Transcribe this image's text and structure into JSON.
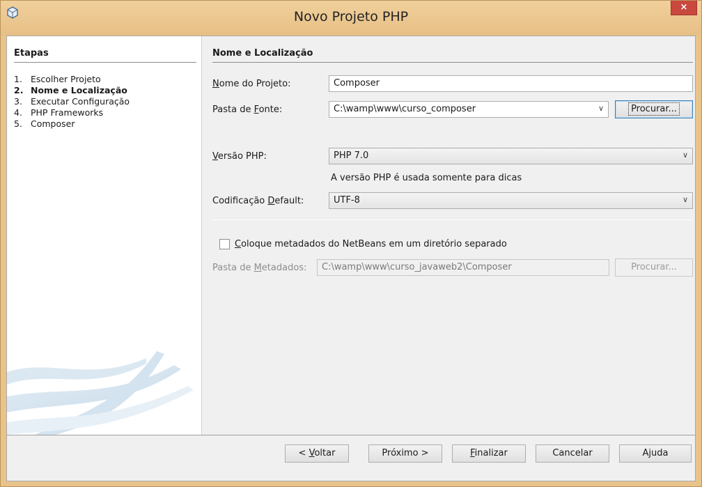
{
  "window": {
    "title": "Novo Projeto PHP",
    "close_label": "×"
  },
  "steps": {
    "title": "Etapas",
    "items": [
      {
        "num": "1.",
        "label": "Escolher Projeto",
        "current": false
      },
      {
        "num": "2.",
        "label": "Nome e Localização",
        "current": true
      },
      {
        "num": "3.",
        "label": "Executar Configuração",
        "current": false
      },
      {
        "num": "4.",
        "label": "PHP Frameworks",
        "current": false
      },
      {
        "num": "5.",
        "label": "Composer",
        "current": false
      }
    ]
  },
  "form": {
    "section_title": "Nome e Localização",
    "project_name": {
      "label_pre": "",
      "label_u": "N",
      "label_post": "ome do Projeto:",
      "value": "Composer"
    },
    "source_folder": {
      "label_pre": "Pasta de ",
      "label_u": "F",
      "label_post": "onte:",
      "value": "C:\\wamp\\www\\curso_composer",
      "browse_label": "Procurar..."
    },
    "php_version": {
      "label_pre": "",
      "label_u": "V",
      "label_post": "ersão PHP:",
      "value": "PHP 7.0",
      "hint": "A versão PHP é usada somente para dicas"
    },
    "encoding": {
      "label_pre": "Codificação ",
      "label_u": "D",
      "label_post": "efault:",
      "value": "UTF-8"
    },
    "metadata_checkbox": {
      "label_pre": "",
      "label_u": "C",
      "label_post": "oloque metadados do NetBeans em um diretório separado",
      "checked": false
    },
    "metadata_folder": {
      "label_pre": "Pasta de ",
      "label_u": "M",
      "label_post": "etadados:",
      "value": "C:\\wamp\\www\\curso_javaweb2\\Composer",
      "browse_label": "Procurar..."
    }
  },
  "buttons": {
    "back": {
      "pre": "< ",
      "u": "V",
      "post": "oltar"
    },
    "next": "Próximo >",
    "finish": {
      "pre": "",
      "u": "F",
      "post": "inalizar"
    },
    "cancel": "Cancelar",
    "help": {
      "pre": "A",
      "u": "j",
      "post": "uda"
    }
  },
  "colors": {
    "title_bar": "#e6bf85",
    "close_button": "#c9483e",
    "focus_border": "#3c7fb1"
  }
}
